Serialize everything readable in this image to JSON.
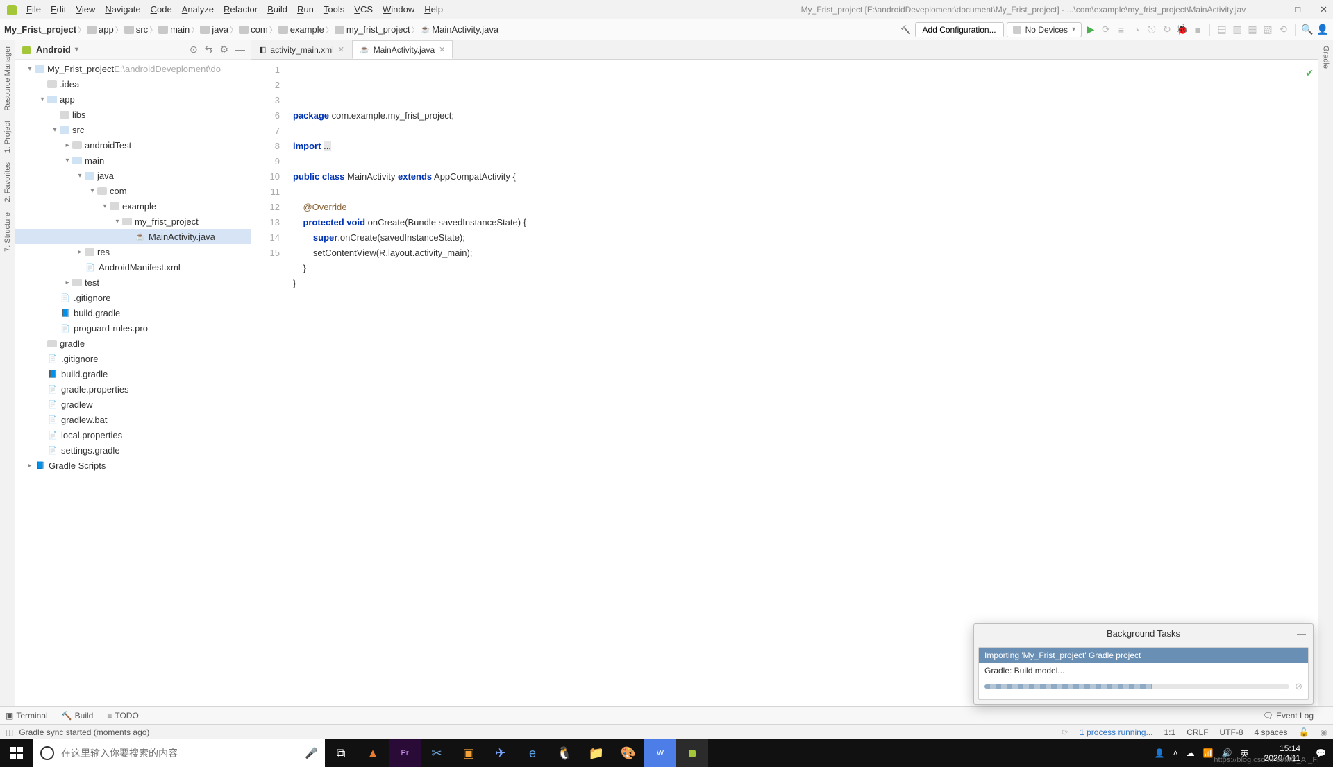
{
  "menu": {
    "items": [
      "File",
      "Edit",
      "View",
      "Navigate",
      "Code",
      "Analyze",
      "Refactor",
      "Build",
      "Run",
      "Tools",
      "VCS",
      "Window",
      "Help"
    ],
    "title": "My_Frist_project [E:\\androidDeveploment\\document\\My_Frist_project] - ...\\com\\example\\my_frist_project\\MainActivity.jav"
  },
  "window_buttons": {
    "min": "—",
    "max": "□",
    "close": "✕"
  },
  "breadcrumb": [
    {
      "label": "My_Frist_project",
      "bold": true
    },
    {
      "label": "app",
      "icon": "folder"
    },
    {
      "label": "src",
      "icon": "folder"
    },
    {
      "label": "main",
      "icon": "folder"
    },
    {
      "label": "java",
      "icon": "folder"
    },
    {
      "label": "com",
      "icon": "folder"
    },
    {
      "label": "example",
      "icon": "folder"
    },
    {
      "label": "my_frist_project",
      "icon": "folder"
    },
    {
      "label": "MainActivity.java",
      "icon": "java"
    }
  ],
  "toolbar": {
    "add_config": "Add Configuration...",
    "devices": "No Devices"
  },
  "left_rail": [
    "Resource Manager",
    "1: Project",
    "2: Favorites",
    "7: Structure"
  ],
  "right_rail": [
    "Gradle"
  ],
  "project_header": {
    "title": "Android"
  },
  "tree": [
    {
      "d": 0,
      "a": "▾",
      "ico": "mod",
      "label": "My_Frist_project",
      "dim": "E:\\androidDeveploment\\do"
    },
    {
      "d": 1,
      "a": "",
      "ico": "folder",
      "label": ".idea"
    },
    {
      "d": 1,
      "a": "▾",
      "ico": "mod",
      "label": "app"
    },
    {
      "d": 2,
      "a": "",
      "ico": "folder",
      "label": "libs"
    },
    {
      "d": 2,
      "a": "▾",
      "ico": "mod",
      "label": "src"
    },
    {
      "d": 3,
      "a": "▸",
      "ico": "folder",
      "label": "androidTest"
    },
    {
      "d": 3,
      "a": "▾",
      "ico": "mod",
      "label": "main"
    },
    {
      "d": 4,
      "a": "▾",
      "ico": "mod",
      "label": "java"
    },
    {
      "d": 5,
      "a": "▾",
      "ico": "folder",
      "label": "com"
    },
    {
      "d": 6,
      "a": "▾",
      "ico": "folder",
      "label": "example"
    },
    {
      "d": 7,
      "a": "▾",
      "ico": "folder",
      "label": "my_frist_project"
    },
    {
      "d": 8,
      "a": "",
      "ico": "java",
      "label": "MainActivity.java",
      "sel": true
    },
    {
      "d": 4,
      "a": "▸",
      "ico": "folder",
      "label": "res"
    },
    {
      "d": 4,
      "a": "",
      "ico": "xml",
      "label": "AndroidManifest.xml"
    },
    {
      "d": 3,
      "a": "▸",
      "ico": "folder",
      "label": "test"
    },
    {
      "d": 2,
      "a": "",
      "ico": "file",
      "label": ".gitignore"
    },
    {
      "d": 2,
      "a": "",
      "ico": "gradle",
      "label": "build.gradle"
    },
    {
      "d": 2,
      "a": "",
      "ico": "file",
      "label": "proguard-rules.pro"
    },
    {
      "d": 1,
      "a": "",
      "ico": "folder",
      "label": "gradle"
    },
    {
      "d": 1,
      "a": "",
      "ico": "file",
      "label": ".gitignore"
    },
    {
      "d": 1,
      "a": "",
      "ico": "gradle",
      "label": "build.gradle"
    },
    {
      "d": 1,
      "a": "",
      "ico": "file",
      "label": "gradle.properties"
    },
    {
      "d": 1,
      "a": "",
      "ico": "file",
      "label": "gradlew"
    },
    {
      "d": 1,
      "a": "",
      "ico": "file",
      "label": "gradlew.bat"
    },
    {
      "d": 1,
      "a": "",
      "ico": "file",
      "label": "local.properties"
    },
    {
      "d": 1,
      "a": "",
      "ico": "file",
      "label": "settings.gradle"
    },
    {
      "d": 0,
      "a": "▸",
      "ico": "gradle",
      "label": "Gradle Scripts"
    }
  ],
  "tabs": [
    {
      "label": "activity_main.xml",
      "active": false
    },
    {
      "label": "MainActivity.java",
      "active": true
    }
  ],
  "code_lines": [
    {
      "n": 1,
      "html": "<span class='kw'>package</span> com.example.my_frist_project;",
      "hl": true
    },
    {
      "n": 2,
      "html": ""
    },
    {
      "n": 3,
      "html": "<span class='kw'>import</span> <span style='background:#e7e7e7;'>...</span>"
    },
    {
      "n": 6,
      "html": ""
    },
    {
      "n": 7,
      "html": "<span class='kw'>public class</span> MainActivity <span class='kw'>extends</span> AppCompatActivity {"
    },
    {
      "n": 8,
      "html": ""
    },
    {
      "n": 9,
      "html": "    <span class='ann'>@Override</span>"
    },
    {
      "n": 10,
      "html": "    <span class='kw'>protected void</span> onCreate(Bundle savedInstanceState) {"
    },
    {
      "n": 11,
      "html": "        <span class='kw'>super</span>.onCreate(savedInstanceState);"
    },
    {
      "n": 12,
      "html": "        setContentView(R.layout.activity_main);"
    },
    {
      "n": 13,
      "html": "    }"
    },
    {
      "n": 14,
      "html": "}"
    },
    {
      "n": 15,
      "html": ""
    }
  ],
  "bg_tasks": {
    "title": "Background Tasks",
    "task": "Importing 'My_Frist_project' Gradle project",
    "sub": "Gradle: Build model..."
  },
  "tool_windows": {
    "terminal": "Terminal",
    "build": "Build",
    "todo": "TODO",
    "event_log": "Event Log"
  },
  "status": {
    "msg": "Gradle sync started (moments ago)",
    "proc": "1 process running...",
    "pos": "1:1",
    "sep": "CRLF",
    "enc": "UTF-8",
    "indent": "4 spaces"
  },
  "taskbar": {
    "search_placeholder": "在这里输入你要搜索的内容",
    "time": "15:14",
    "date": "2020/4/11",
    "ime": "英",
    "ghost": "https://blog.csdn.net/MO_AI_FI"
  }
}
